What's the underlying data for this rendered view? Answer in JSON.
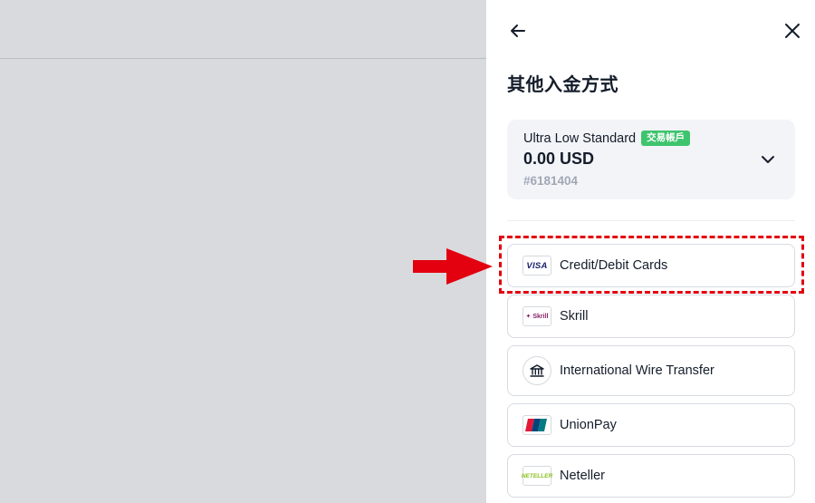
{
  "panel": {
    "title": "其他入金方式",
    "back_icon": "arrow-left-icon",
    "close_icon": "close-icon"
  },
  "account": {
    "name": "Ultra Low Standard",
    "badge": "交易帳戶",
    "balance": "0.00 USD",
    "number": "#6181404",
    "badge_color": "#3fc46e"
  },
  "methods": [
    {
      "label": "Credit/Debit Cards",
      "icon": "visa-icon",
      "icon_text": "VISA"
    },
    {
      "label": "Skrill",
      "icon": "skrill-icon",
      "icon_text": "Skrill"
    },
    {
      "label": "International Wire Transfer",
      "icon": "bank-icon"
    },
    {
      "label": "UnionPay",
      "icon": "unionpay-icon"
    },
    {
      "label": "Neteller",
      "icon": "neteller-icon",
      "icon_text": "NETELLER"
    }
  ],
  "annotation": {
    "color": "#e3000f",
    "arrow_icon": "red-arrow-icon"
  }
}
